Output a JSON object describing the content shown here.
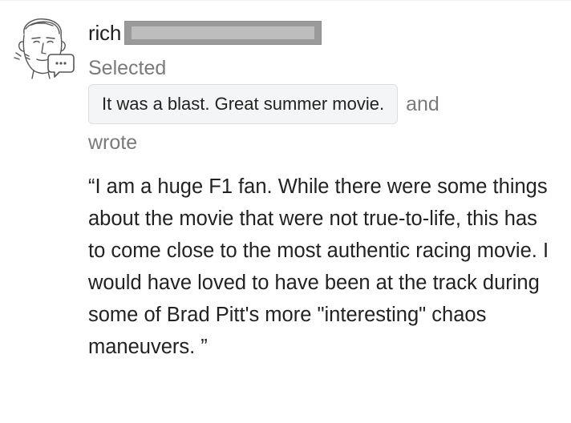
{
  "comment": {
    "username": "rich",
    "selected_label": "Selected",
    "choice": "It was a blast. Great summer movie.",
    "and_label": "and",
    "wrote_label": "wrote",
    "review_text": "“I am a huge F1 fan. While there were some things about the movie that were not true-to-life, this has to come close to the most authentic racing movie. I would have loved to have been at the track during some of Brad Pitt's more \"interesting\" chaos maneuvers. ”"
  },
  "icons": {
    "avatar": "sketch-face-avatar",
    "badge": "speech-bubble-icon"
  }
}
